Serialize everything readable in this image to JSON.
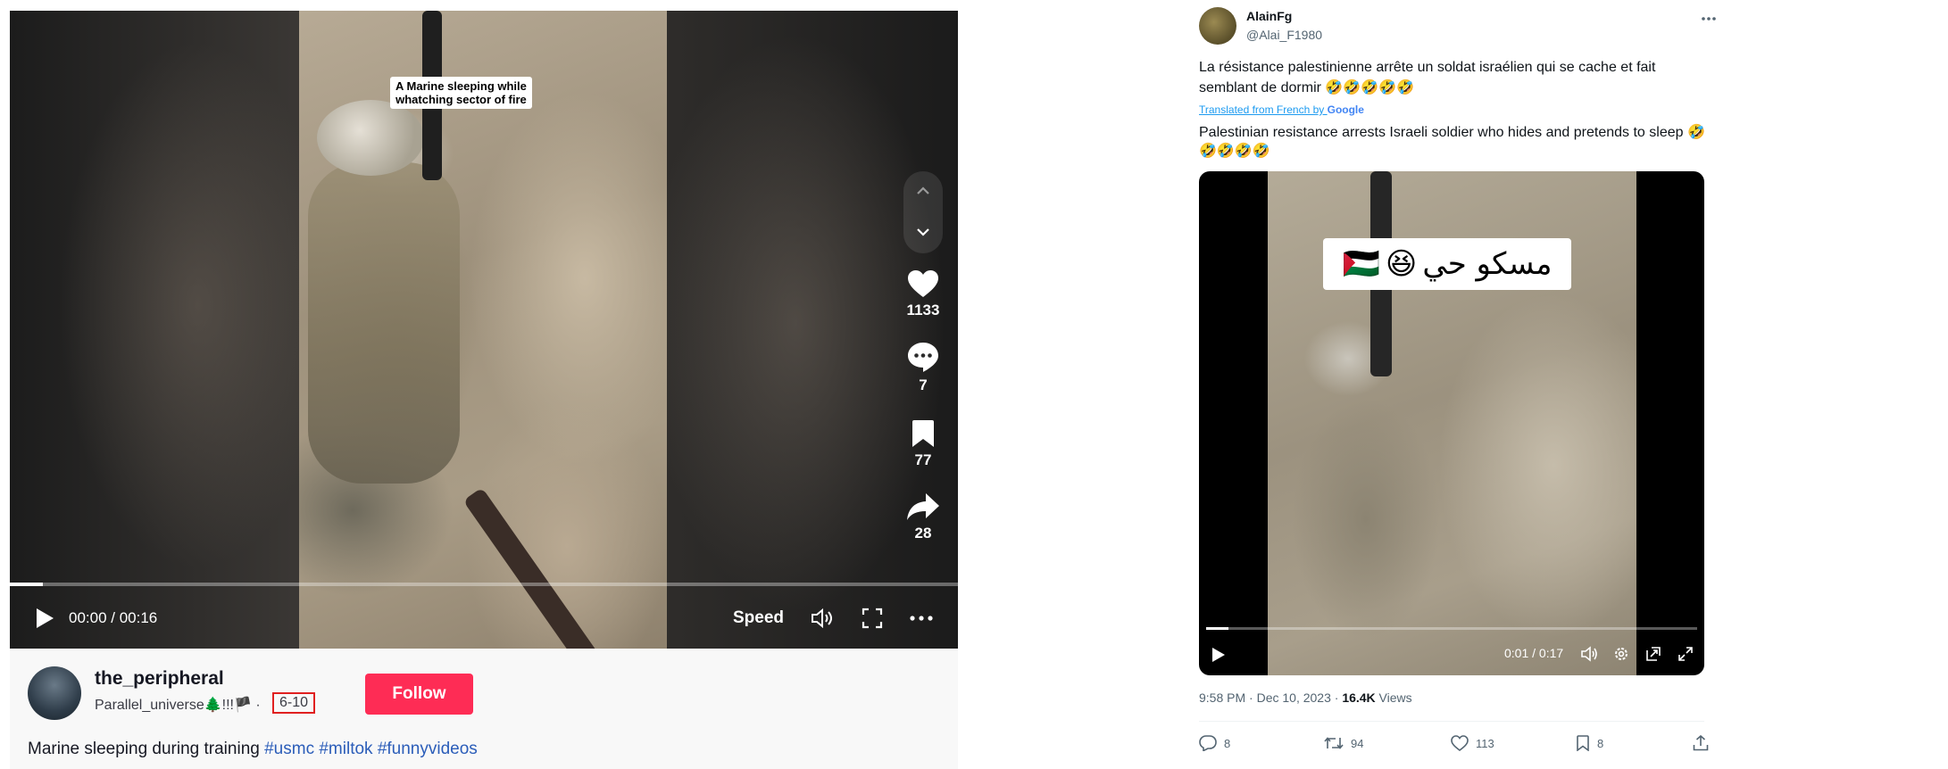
{
  "tiktok": {
    "video_caption": "A Marine sleeping while\nwhatching sector of fire",
    "actions": {
      "likes": "1133",
      "comments": "7",
      "bookmarks": "77",
      "shares": "28"
    },
    "player": {
      "time": "00:00 / 00:16",
      "speed_label": "Speed",
      "progress_fraction": 0.035
    },
    "author": {
      "username": "the_peripheral",
      "nickname": "Parallel_universe🌲!!!🏴",
      "separator": " · ",
      "date": "6-10"
    },
    "follow_label": "Follow",
    "description": {
      "text": "Marine sleeping during training ",
      "tags": [
        "#usmc",
        "#miltok",
        "#funnyvideos"
      ]
    },
    "colors": {
      "follow": "#fe2c55",
      "tag": "#2b5db9",
      "highlight_box": "#e02020"
    }
  },
  "tweet": {
    "display_name": "AlainFg",
    "handle": "@Alai_F1980",
    "text_original": "La résistance palestinienne arrête un soldat israélien qui se cache et fait semblant de dormir 🤣🤣🤣🤣🤣",
    "translated_prefix": "Translated from French by ",
    "translated_by": "Google",
    "text_translated": "Palestinian resistance arrests Israeli soldier who hides and pretends to sleep 🤣🤣🤣🤣🤣",
    "video_overlay_text": "مسكو حي",
    "video_overlay_emoji": "😆",
    "video_overlay_flag": "🇵🇸",
    "player": {
      "time": "0:01 / 0:17",
      "progress_fraction": 0.045
    },
    "timestamp": "9:58 PM · Dec 10, 2023 · ",
    "views_count": "16.4K",
    "views_label": " Views",
    "stats": {
      "replies": "8",
      "retweets": "94",
      "likes": "113",
      "bookmarks": "8"
    },
    "colors": {
      "link": "#1d9bf0",
      "muted": "#536471"
    }
  }
}
